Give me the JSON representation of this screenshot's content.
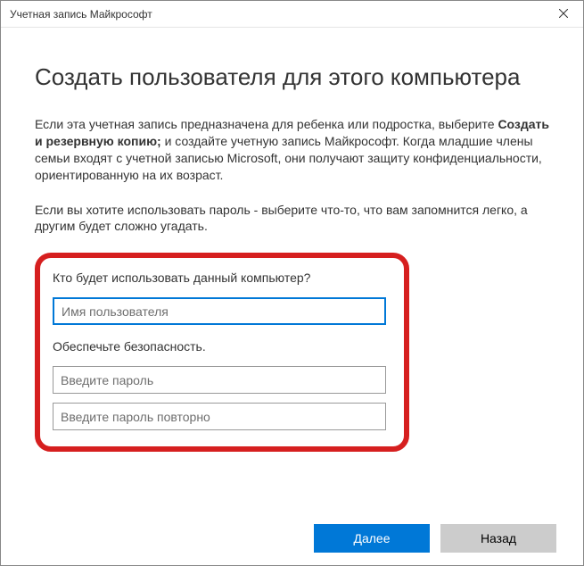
{
  "titlebar": {
    "title": "Учетная запись Майкрософт"
  },
  "heading": "Создать пользователя для этого компьютера",
  "para1_pre": "Если эта учетная запись предназначена для ребенка или подростка, выберите ",
  "para1_bold": "Создать и резервную копию;",
  "para1_post": " и создайте учетную запись Майкрософт. Когда младшие члены семьи входят с учетной записью Microsoft, они получают защиту конфиденциальности, ориентированную на их возраст.",
  "para2": "Если вы хотите использовать пароль - выберите что-то, что вам запомнится легко, а другим будет сложно угадать.",
  "section1_label": "Кто будет использовать данный компьютер?",
  "username_placeholder": "Имя пользователя",
  "section2_label": "Обеспечьте безопасность.",
  "password_placeholder": "Введите пароль",
  "password2_placeholder": "Введите пароль повторно",
  "buttons": {
    "next": "Далее",
    "back": "Назад"
  }
}
